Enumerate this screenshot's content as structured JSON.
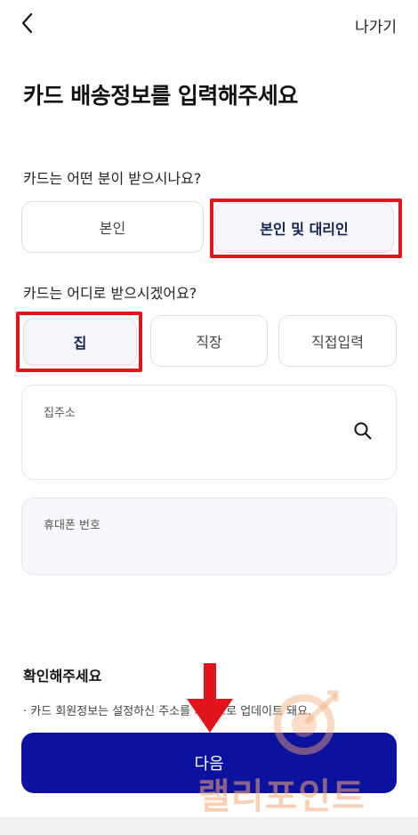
{
  "header": {
    "exit_label": "나가기"
  },
  "title": "카드 배송정보를 입력해주세요",
  "recipient": {
    "question": "카드는 어떤 분이 받으시나요?",
    "options": [
      "본인",
      "본인 및 대리인"
    ],
    "selected": "본인 및 대리인"
  },
  "location": {
    "question": "카드는 어디로 받으시겠어요?",
    "options": [
      "집",
      "직장",
      "직접입력"
    ],
    "selected": "집"
  },
  "fields": {
    "address_label": "집주소",
    "phone_label": "휴대폰 번호"
  },
  "confirm": {
    "title": "확인해주세요",
    "notice": "· 카드 회원정보는 설정하신 주소를 기준으로 업데이트 돼요."
  },
  "next_label": "다음",
  "watermark": "랠리포인트",
  "colors": {
    "primary": "#0c119e",
    "highlight": "#e1141b",
    "selected_bg": "#f5f6fa"
  }
}
